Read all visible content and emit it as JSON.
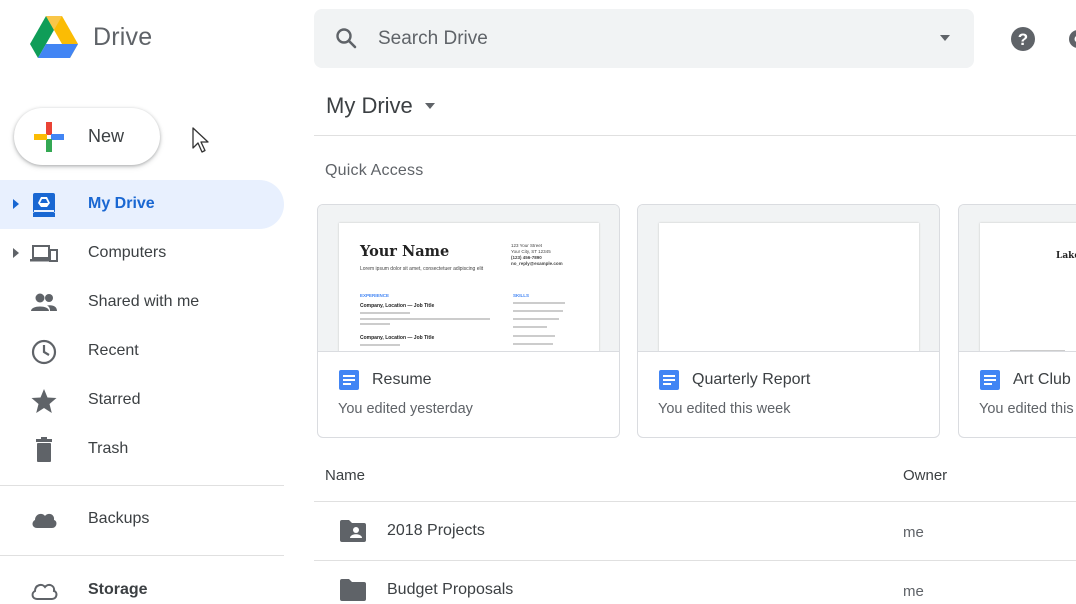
{
  "app": {
    "name": "Drive"
  },
  "search": {
    "placeholder": "Search Drive"
  },
  "new_button": {
    "label": "New"
  },
  "sidebar": {
    "items": [
      {
        "label": "My Drive",
        "icon": "my-drive-icon",
        "active": true
      },
      {
        "label": "Computers",
        "icon": "computers-icon"
      },
      {
        "label": "Shared with me",
        "icon": "shared-icon"
      },
      {
        "label": "Recent",
        "icon": "clock-icon"
      },
      {
        "label": "Starred",
        "icon": "star-icon"
      },
      {
        "label": "Trash",
        "icon": "trash-icon"
      },
      {
        "label": "Backups",
        "icon": "cloud-icon"
      },
      {
        "label": "Storage",
        "icon": "cloud-outline-icon"
      }
    ]
  },
  "main": {
    "title": "My Drive",
    "quick_access": {
      "label": "Quick Access",
      "cards": [
        {
          "name": "Resume",
          "subtitle": "You edited yesterday"
        },
        {
          "name": "Quarterly Report",
          "subtitle": "You edited this week"
        },
        {
          "name": "Art Club N",
          "subtitle": "You edited this w"
        }
      ]
    },
    "resume_preview": {
      "name": "Your Name",
      "tagline": "Lorem ipsum dolor sit amet, consectetuer adipiscing elit",
      "contact": [
        "123 Your Street",
        "Your City, ST 12345",
        "(123) 456-7890",
        "no_reply@example.com"
      ],
      "experience_label": "EXPERIENCE",
      "skills_label": "SKILLS",
      "job1": "Company, Location — Job Title",
      "job2": "Company, Location — Job Title"
    },
    "art_preview": {
      "heading": "Lake"
    },
    "list": {
      "columns": {
        "name": "Name",
        "owner": "Owner"
      },
      "rows": [
        {
          "name": "2018 Projects",
          "owner": "me",
          "icon": "shared-folder-icon"
        },
        {
          "name": "Budget Proposals",
          "owner": "me",
          "icon": "folder-icon"
        }
      ]
    }
  },
  "colors": {
    "accent": "#1967d2",
    "active_bg": "#e8f0fe",
    "doc_blue": "#4285f4"
  }
}
